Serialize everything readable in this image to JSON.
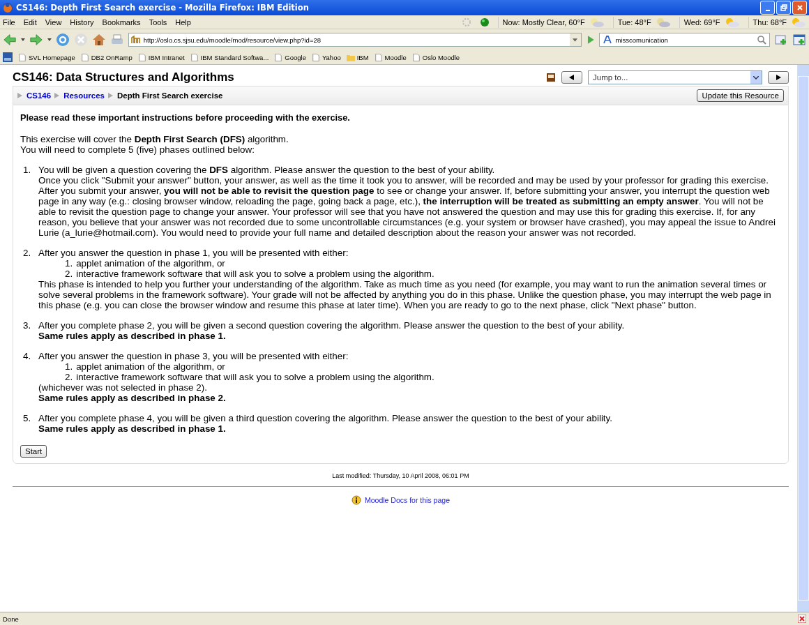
{
  "window": {
    "title": "CS146: Depth First Search exercise - Mozilla Firefox: IBM Edition"
  },
  "menu": [
    "File",
    "Edit",
    "View",
    "History",
    "Bookmarks",
    "Tools",
    "Help"
  ],
  "weather": [
    {
      "label": "Now: Mostly Clear, 60°F",
      "kind": "night"
    },
    {
      "label": "Tue: 48°F",
      "kind": "cloud"
    },
    {
      "label": "Wed: 69°F",
      "kind": "sun"
    },
    {
      "label": "Thu: 68°F",
      "kind": "sun"
    }
  ],
  "url": "http://oslo.cs.sjsu.edu/moodle/mod/resource/view.php?id=28",
  "search": {
    "value": "misscomunication"
  },
  "bookmarks": [
    {
      "label": "SVL Homepage",
      "kind": "page"
    },
    {
      "label": "DB2 OnRamp",
      "kind": "page"
    },
    {
      "label": "IBM Intranet",
      "kind": "page"
    },
    {
      "label": "IBM Standard Softwa...",
      "kind": "page"
    },
    {
      "label": "Google",
      "kind": "page"
    },
    {
      "label": "Yahoo",
      "kind": "page"
    },
    {
      "label": "IBM",
      "kind": "folder"
    },
    {
      "label": "Moodle",
      "kind": "page"
    },
    {
      "label": "Oslo Moodle",
      "kind": "page"
    }
  ],
  "page": {
    "course_title": "CS146: Data Structures and Algorithms",
    "jump": {
      "placeholder": "Jump to..."
    },
    "breadcrumb": [
      {
        "label": "CS146",
        "link": true
      },
      {
        "label": "Resources",
        "link": true
      },
      {
        "label": "Depth First Search exercise",
        "link": false
      }
    ],
    "update_button": "Update this Resource",
    "heading": "Please read these important instructions before proceeding with the exercise.",
    "intro": [
      "This exercise will cover the **Depth First Search (DFS)** algorithm.",
      "You will need to complete 5 (five) phases outlined below:"
    ],
    "phases": [
      {
        "number": "1.",
        "blocks": [
          {
            "kind": "para",
            "text": "You will be given a question covering the **DFS** algorithm. Please answer the question to the best of your ability."
          },
          {
            "kind": "para",
            "text": "Once you click \"Submit your answer\" button, your answer, as well as the time it took you to answer, will be recorded and may be used by your professor for grading this exercise. After you submit your answer, **you will not be able to revisit the question page** to see or change your answer. If, before submitting your answer, you interrupt the question web page in any way (e.g.: closing browser window, reloading the page, going back a page, etc.), **the interruption will be treated as submitting an empty answer**. You will not be able to revisit the question page to change your answer. Your professor will see that you have not answered the question and may use this for grading this exercise. If, for any reason, you believe that your answer was not recorded due to some uncontrollable circumstances (e.g. your system or browser have crashed), you may appeal the issue to Andrei Lurie (a_lurie@hotmail.com). You would need to provide your full name and detailed description about the reason your answer was not recorded."
          }
        ]
      },
      {
        "number": "2.",
        "blocks": [
          {
            "kind": "para",
            "text": "After you answer the question in phase 1, you will be presented with either:"
          },
          {
            "kind": "list",
            "items": [
              {
                "number": "1.",
                "text": "applet animation of the algorithm, or"
              },
              {
                "number": "2.",
                "text": "interactive framework software that will ask you to solve a problem using the algorithm."
              }
            ]
          },
          {
            "kind": "para",
            "text": "This phase is intended to help you further your understanding of the algorithm. Take as much time as you need (for example, you may want to run the animation several times or solve several problems in the framework software). Your grade will not be affected by anything you do in this phase. Unlike the question phase, you may interrupt the web page in this phase (e.g. you can close the browser window and resume this phase at later time). When you are ready to go to the next phase, click \"Next phase\" button."
          }
        ]
      },
      {
        "number": "3.",
        "blocks": [
          {
            "kind": "para",
            "text": "After you complete phase 2, you will be given a second question covering the algorithm. Please answer the question to the best of your ability."
          },
          {
            "kind": "rule",
            "text": "Same rules apply as described in phase 1."
          }
        ]
      },
      {
        "number": "4.",
        "blocks": [
          {
            "kind": "para",
            "text": "After you answer the question in phase 3, you will be presented with either:"
          },
          {
            "kind": "list",
            "items": [
              {
                "number": "1.",
                "text": "applet animation of the algorithm, or"
              },
              {
                "number": "2.",
                "text": "interactive framework software that will ask you to solve a problem using the algorithm."
              }
            ]
          },
          {
            "kind": "para",
            "text": "(whichever was not selected in phase 2)."
          },
          {
            "kind": "rule",
            "text": "Same rules apply as described in phase 2."
          }
        ]
      },
      {
        "number": "5.",
        "blocks": [
          {
            "kind": "para",
            "text": "After you complete phase 4, you will be given a third question covering the algorithm. Please answer the question to the best of your ability."
          },
          {
            "kind": "rule",
            "text": "Same rules apply as described in phase 1."
          }
        ]
      }
    ],
    "start_button": "Start",
    "last_modified": "Last modified: Thursday, 10 April 2008, 06:01 PM",
    "docs_link": "Moodle Docs for this page"
  },
  "status_bar": "Done"
}
